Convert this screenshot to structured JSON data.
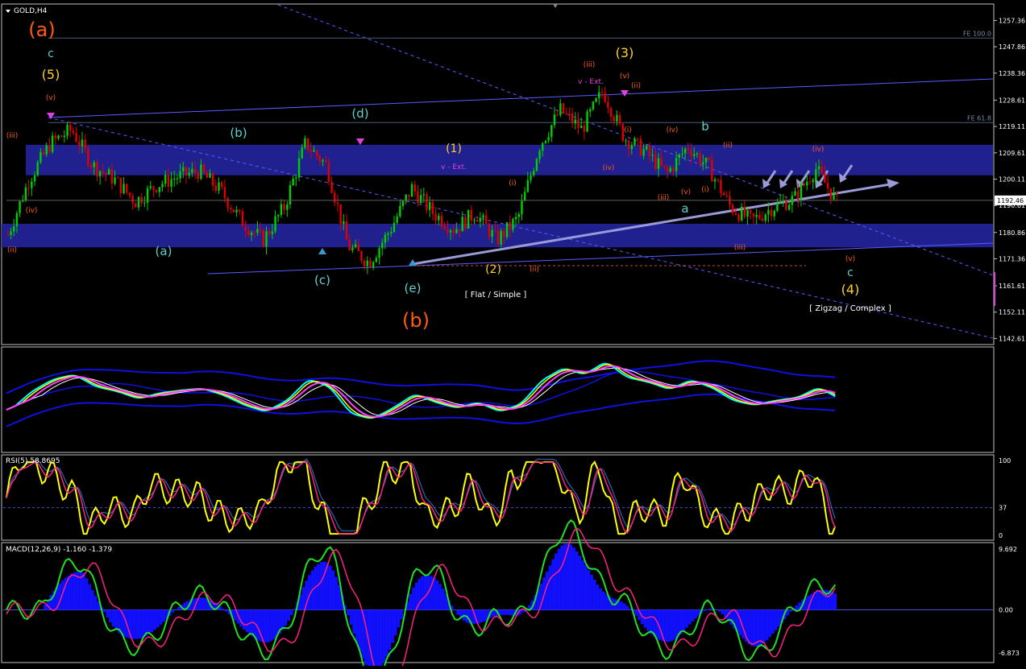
{
  "window": {
    "title": "GOLD,H4"
  },
  "colors": {
    "background": "#000000",
    "frame": "#c0c0c0",
    "bull": "#00d000",
    "bear": "#e00000",
    "zone": "#20208e",
    "channel": "#5b5bff",
    "trend": "#9a9ad8",
    "orange_wave": "#ff5a14",
    "cyan_wave": "#5fd0d0",
    "yellow_wave": "#ffd21e",
    "magenta": "#e040e0",
    "rsi_line": "#ffff00",
    "rsi_signal": "#ff2080",
    "macd_hist": "#1010ff",
    "macd_line": "#20e020",
    "macd_signal": "#ff2080"
  },
  "price_axis": {
    "ticks": [
      "1257.36",
      "1247.86",
      "1238.36",
      "1228.61",
      "1219.11",
      "1209.61",
      "1200.11",
      "1190.61",
      "1180.86",
      "1171.36",
      "1161.61",
      "1152.11",
      "1142.61"
    ],
    "current_price": "1192.46",
    "fib_levels": [
      {
        "label": "FE 100.0",
        "price": 1251.0
      },
      {
        "label": "FE 61.8",
        "price": 1220.5
      }
    ]
  },
  "chart_data": [
    {
      "type": "candlestick",
      "title": "GOLD,H4",
      "ylim": [
        1140.7,
        1263.0
      ],
      "zones": [
        [
          1201.5,
          1212.5
        ],
        [
          1175.5,
          1184.0
        ]
      ],
      "series_anchors_price": [
        1180,
        1200,
        1213,
        1218,
        1205,
        1200,
        1192,
        1198,
        1201,
        1203,
        1196,
        1185,
        1178,
        1190,
        1213,
        1205,
        1176,
        1170,
        1182,
        1197,
        1188,
        1182,
        1188,
        1178,
        1186,
        1212,
        1225,
        1218,
        1232,
        1215,
        1210,
        1202,
        1212,
        1204,
        1190,
        1185,
        1190,
        1193,
        1204,
        1192
      ],
      "annotations": [
        {
          "text": "(a)",
          "color": "orange"
        },
        {
          "text": "(b)",
          "color": "orange"
        },
        {
          "text": "c",
          "color": "cyan"
        },
        {
          "text": "(5)",
          "color": "yellow"
        },
        {
          "text": "(3)",
          "color": "yellow"
        },
        {
          "text": "(1)",
          "color": "yellow"
        },
        {
          "text": "(2)",
          "color": "yellow"
        },
        {
          "text": "(4)",
          "color": "yellow"
        },
        {
          "text": "(a)",
          "color": "cyan"
        },
        {
          "text": "(b)",
          "color": "cyan"
        },
        {
          "text": "(c)",
          "color": "cyan"
        },
        {
          "text": "(d)",
          "color": "cyan"
        },
        {
          "text": "(e)",
          "color": "cyan"
        },
        {
          "text": "a",
          "color": "cyan"
        },
        {
          "text": "b",
          "color": "cyan"
        },
        {
          "text": "c",
          "color": "cyan"
        },
        {
          "text": "v - Ext.",
          "color": "magenta"
        },
        {
          "text": "v - Ext.",
          "color": "magenta"
        },
        {
          "text": "[ Flat / Simple ]",
          "color": "white"
        },
        {
          "text": "[ Zigzag / Complex ]",
          "color": "white"
        },
        {
          "text": "(iii)",
          "color": "orange"
        },
        {
          "text": "(iv)",
          "color": "orange"
        },
        {
          "text": "(ii)",
          "color": "orange"
        },
        {
          "text": "(v)",
          "color": "orange"
        },
        {
          "text": "(iii)",
          "color": "orange"
        },
        {
          "text": "(v)",
          "color": "orange"
        },
        {
          "text": "(ii)",
          "color": "orange"
        },
        {
          "text": "(i)",
          "color": "orange"
        },
        {
          "text": "(iv)",
          "color": "orange"
        },
        {
          "text": "(iv)",
          "color": "orange"
        },
        {
          "text": "(iii)",
          "color": "orange"
        },
        {
          "text": "(v)",
          "color": "orange"
        },
        {
          "text": "(i)",
          "color": "orange"
        },
        {
          "text": "(ii)",
          "color": "orange"
        },
        {
          "text": "(iv)",
          "color": "orange"
        },
        {
          "text": "(iii)",
          "color": "orange"
        },
        {
          "text": "(v)",
          "color": "orange"
        },
        {
          "text": "(i)",
          "color": "orange"
        },
        {
          "text": "(ii)",
          "color": "orange"
        },
        {
          "text": "(ii)",
          "color": "orange"
        }
      ]
    },
    {
      "type": "line",
      "title": "",
      "series": [
        {
          "values": [
            0.5,
            0.6,
            0.45,
            0.55,
            0.5
          ]
        }
      ]
    },
    {
      "type": "line",
      "title": "RSI(5) 58.8695",
      "ylim": [
        0,
        100
      ],
      "ticks": [
        "100",
        "37",
        "0"
      ],
      "level": 37
    },
    {
      "type": "bar",
      "title": "MACD(12,26,9) -1.160 -1.379",
      "ylim": [
        -6.873,
        9.692
      ],
      "ticks": [
        "9.692",
        "0.00",
        "-6.873"
      ],
      "macd": -1.16,
      "signal": -1.379
    }
  ]
}
